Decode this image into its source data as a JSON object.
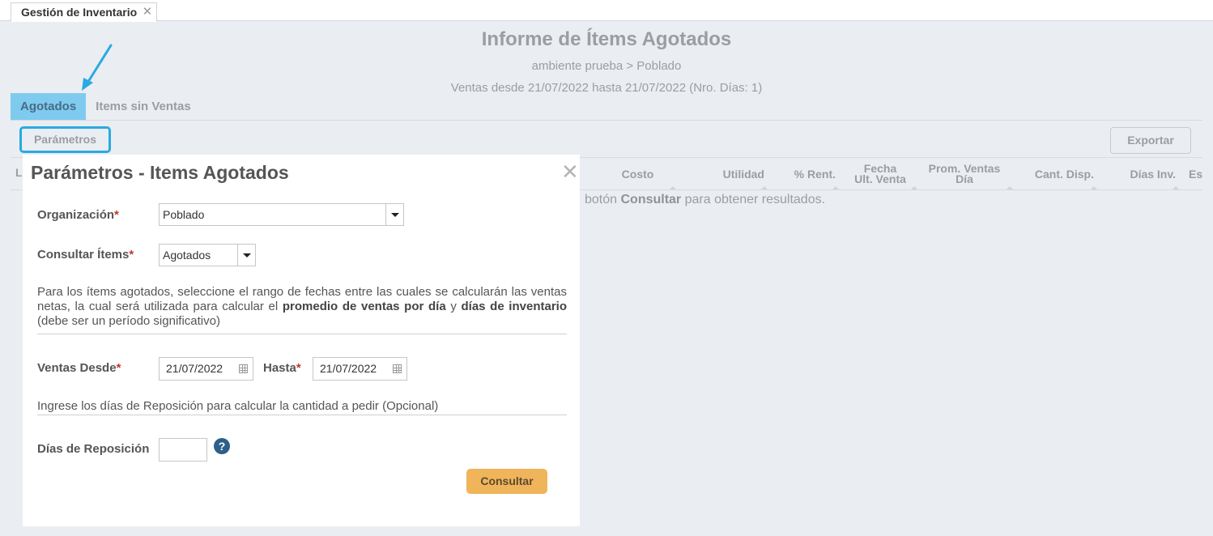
{
  "window": {
    "tab_label": "Gestión de Inventario",
    "tab_close": "✕"
  },
  "report": {
    "title": "Informe de Ítems Agotados",
    "breadcrumb": "ambiente prueba > Poblado",
    "date_range": "Ventas desde 21/07/2022 hasta 21/07/2022 (Nro. Días: 1)"
  },
  "tabs": [
    {
      "label": "Agotados",
      "active": true
    },
    {
      "label": "Items sin Ventas",
      "active": false
    }
  ],
  "toolbar": {
    "params_label": "Parámetros",
    "export_label": "Exportar"
  },
  "grid": {
    "first_col_clip": "L",
    "columns": [
      "Costo",
      "Utilidad",
      "% Rent.",
      "Fecha Ult. Venta",
      "Prom. Ventas Día",
      "Cant. Disp.",
      "Días Inv.",
      "Es"
    ],
    "col_fecha_1": "Fecha",
    "col_fecha_2": "Ult. Venta",
    "col_prom_1": "Prom. Ventas",
    "col_prom_2": "Día",
    "empty_prefix": "botón ",
    "empty_bold": "Consultar",
    "empty_suffix": " para obtener resultados."
  },
  "modal": {
    "title": "Parámetros - Items Agotados",
    "close": "✕",
    "organizacion_label": "Organización",
    "organizacion_value": "Poblado",
    "consultar_label": "Consultar Ítems",
    "consultar_value": "Agotados",
    "required_mark": "*",
    "help1_a": "Para los ítems agotados, seleccione el rango de fechas entre las cuales se calcularán las ventas netas, la cual será utilizada para calcular el ",
    "help1_b": "promedio de ventas por día",
    "help1_c": " y ",
    "help1_d": "días de inventario",
    "help1_e": " (debe ser un período significativo)",
    "ventas_desde_label": "Ventas Desde",
    "ventas_desde_value": "21/07/2022",
    "hasta_label": "Hasta",
    "hasta_value": "21/07/2022",
    "help2": "Ingrese los días de Reposición para calcular la cantidad a pedir (Opcional)",
    "dias_reposicion_label": "Días de Reposición",
    "dias_reposicion_value": "",
    "help_icon": "?",
    "consultar_button": "Consultar"
  },
  "colors": {
    "accent": "#29aae2",
    "active_tab": "#7ecbef",
    "primary_button": "#f0b45a",
    "required": "#c0392b"
  }
}
